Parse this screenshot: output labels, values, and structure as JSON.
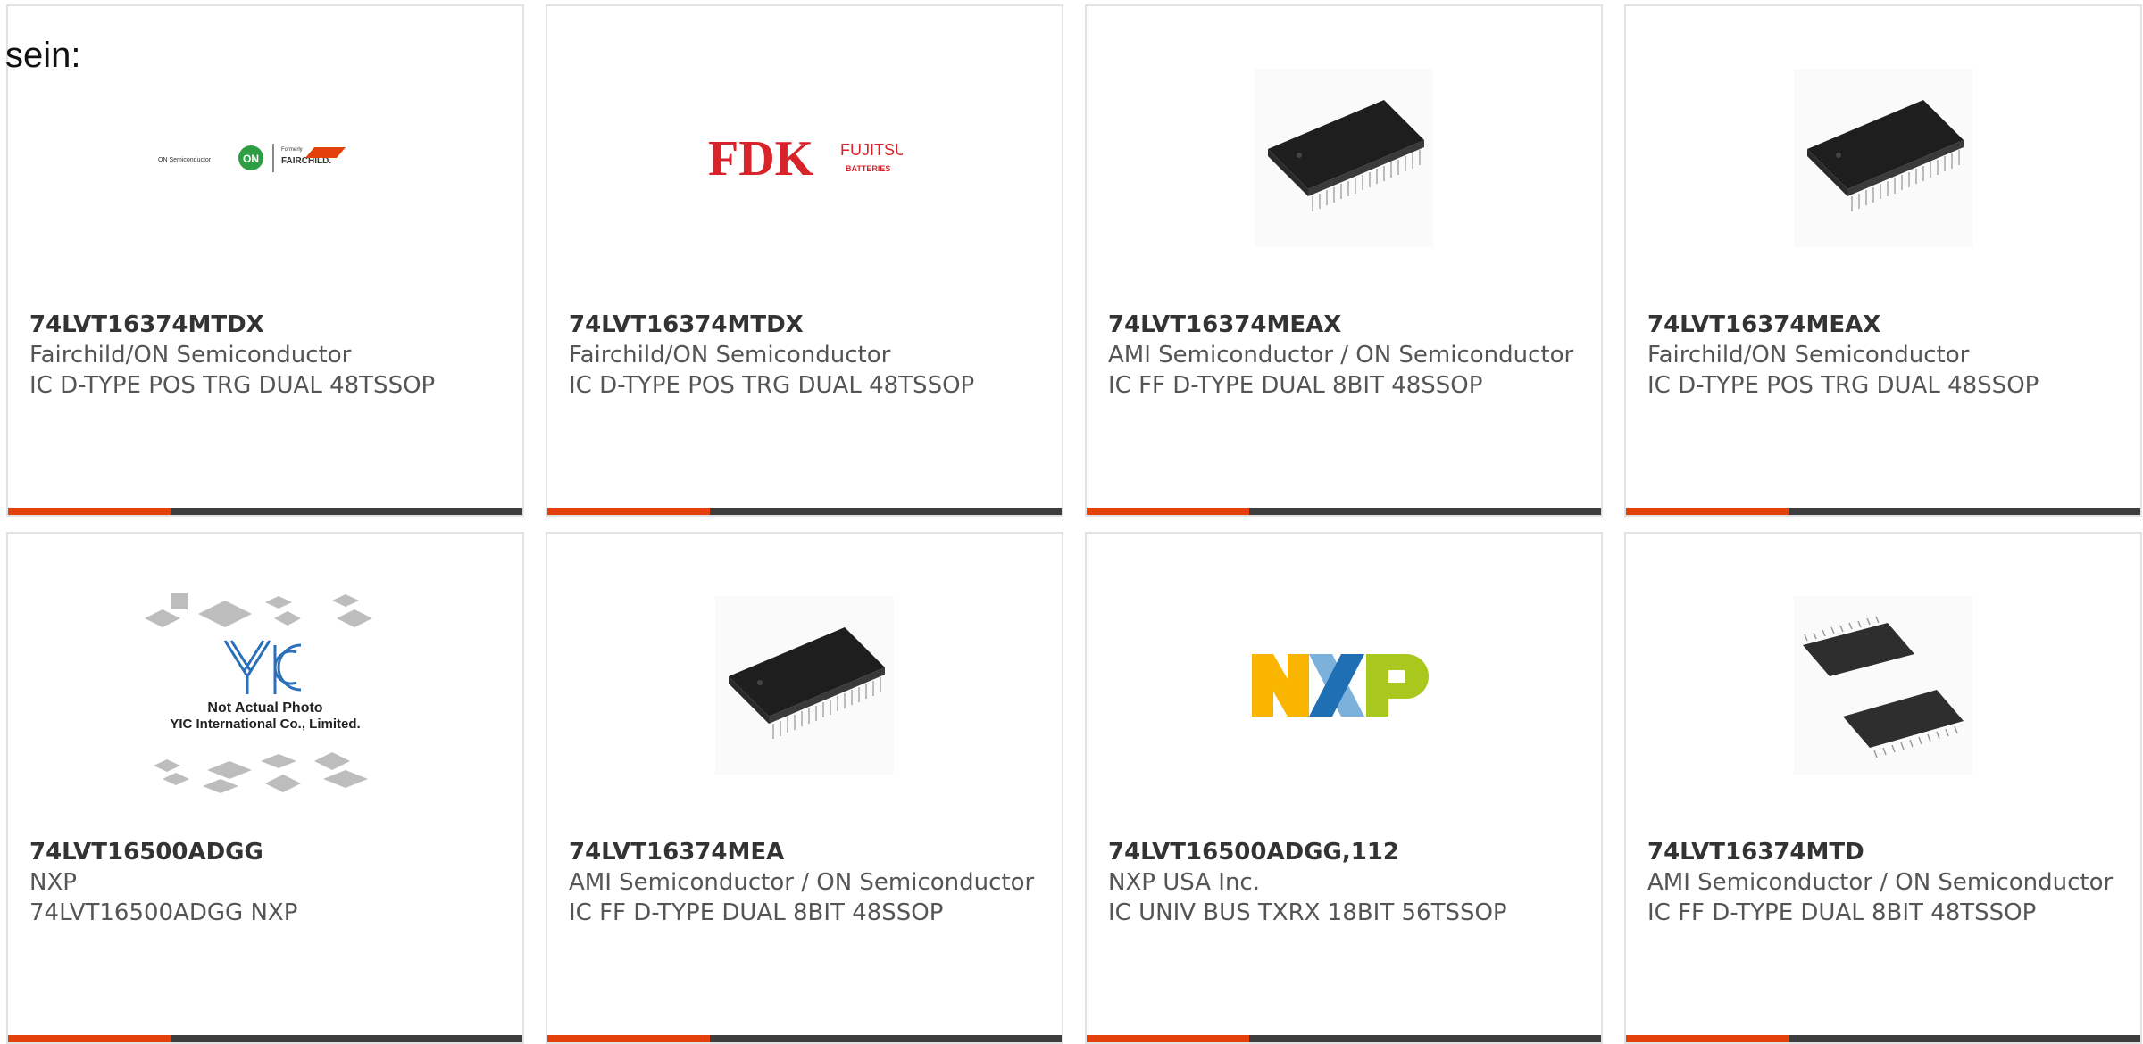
{
  "page": {
    "heading": "sein:"
  },
  "colors": {
    "accent": "#e4400c",
    "bar": "#3d3d3d",
    "fdk_red": "#d8232a",
    "onsemi_green": "#2e9e44"
  },
  "cards": [
    {
      "part": "74LVT16374MTDX",
      "maker": "Fairchild/ON Semiconductor",
      "desc": "IC D-TYPE POS TRG DUAL 48TSSOP",
      "image": "onsemi-fairchild-logo",
      "logo": {
        "left": "ON Semiconductor",
        "formerly": "Formerly",
        "brand": "FAIRCHILD."
      }
    },
    {
      "part": "74LVT16374MTDX",
      "maker": "Fairchild/ON Semiconductor",
      "desc": "IC D-TYPE POS TRG DUAL 48TSSOP",
      "image": "fdk-fujitsu-logo",
      "logo": {
        "main": "FDK",
        "sub": "FUJITSU",
        "sub2": "BATTERIES"
      }
    },
    {
      "part": "74LVT16374MEAX",
      "maker": "AMI Semiconductor / ON Semiconductor",
      "desc": "IC FF D-TYPE DUAL 8BIT 48SSOP",
      "image": "ic-chip-ssop"
    },
    {
      "part": "74LVT16374MEAX",
      "maker": "Fairchild/ON Semiconductor",
      "desc": "IC D-TYPE POS TRG DUAL 48SSOP",
      "image": "ic-chip-ssop"
    },
    {
      "part": "74LVT16500ADGG",
      "maker": "NXP",
      "desc": "74LVT16500ADGG NXP",
      "image": "yic-placeholder",
      "logo": {
        "line1": "Not Actual Photo",
        "line2": "YIC International Co., Limited."
      }
    },
    {
      "part": "74LVT16374MEA",
      "maker": "AMI Semiconductor / ON Semiconductor",
      "desc": "IC FF D-TYPE DUAL 8BIT 48SSOP",
      "image": "ic-chip-ssop"
    },
    {
      "part": "74LVT16500ADGG,112",
      "maker": "NXP USA Inc.",
      "desc": "IC UNIV BUS TXRX 18BIT 56TSSOP",
      "image": "nxp-logo"
    },
    {
      "part": "74LVT16374MTD",
      "maker": "AMI Semiconductor / ON Semiconductor",
      "desc": "IC FF D-TYPE DUAL 8BIT 48TSSOP",
      "image": "ic-chip-tssop-pair"
    }
  ]
}
